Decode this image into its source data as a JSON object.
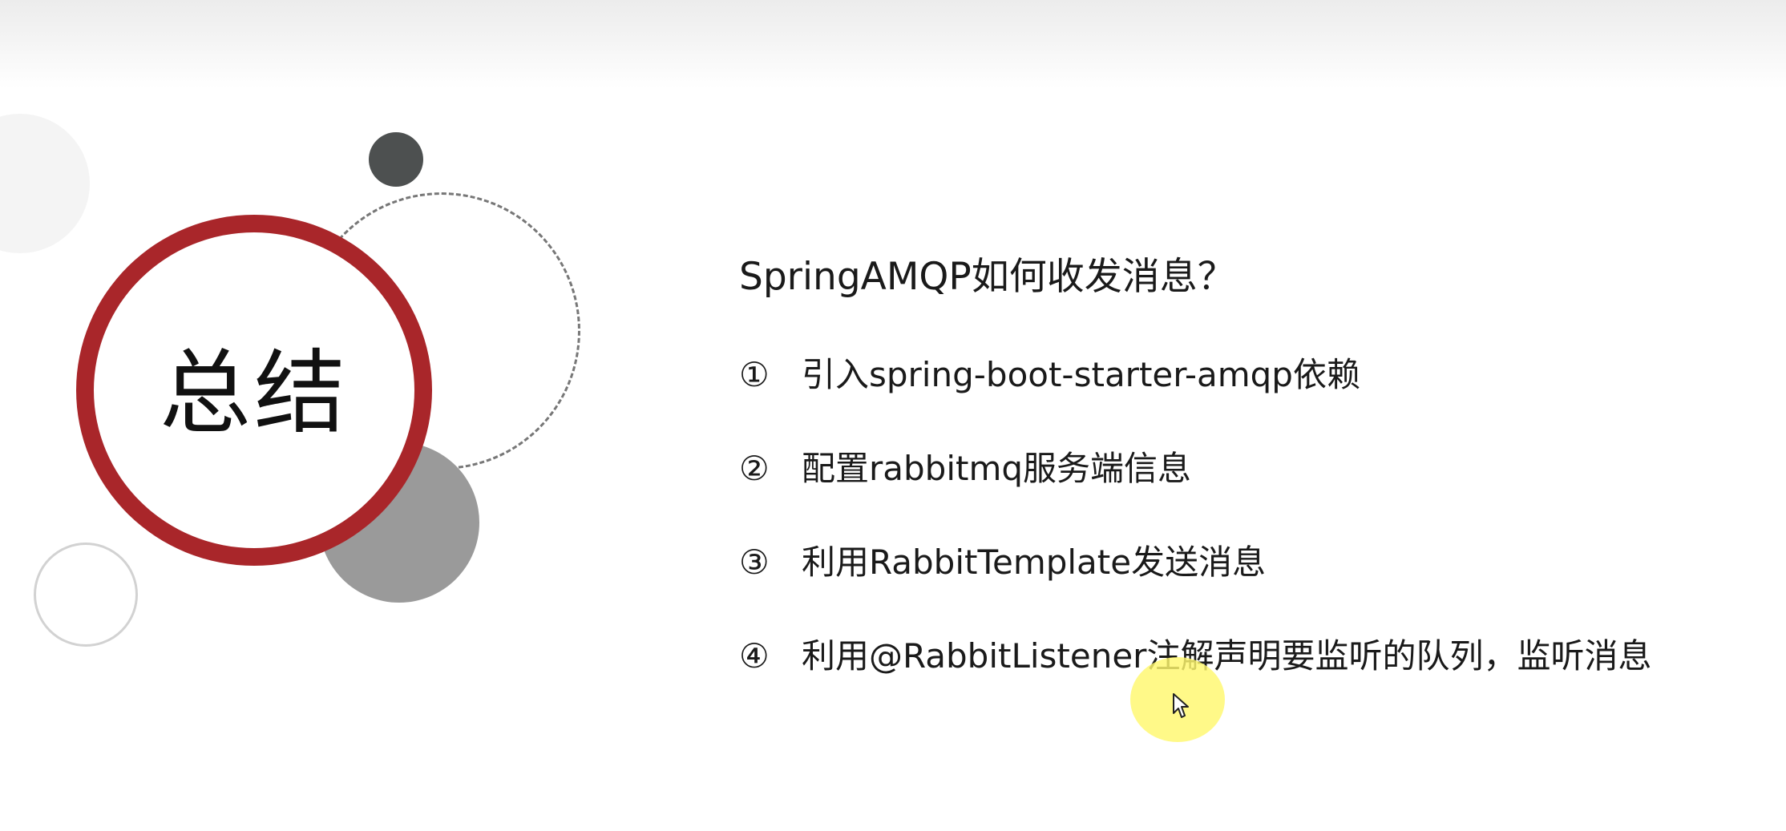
{
  "slide": {
    "title": "总结",
    "question": "SpringAMQP如何收发消息？",
    "items": [
      {
        "num": "①",
        "text": "引入spring-boot-starter-amqp依赖"
      },
      {
        "num": "②",
        "text": "配置rabbitmq服务端信息"
      },
      {
        "num": "③",
        "text": "利用RabbitTemplate发送消息"
      },
      {
        "num": "④",
        "text": "利用@RabbitListener注解声明要监听的队列，监听消息"
      }
    ]
  },
  "colors": {
    "ring": "#a9262a",
    "dark_dot": "#4d5050",
    "gray_dot": "#9a9a9a",
    "cursor_highlight": "#fff86e"
  },
  "icons": {
    "cursor": "mouse-pointer-icon"
  }
}
